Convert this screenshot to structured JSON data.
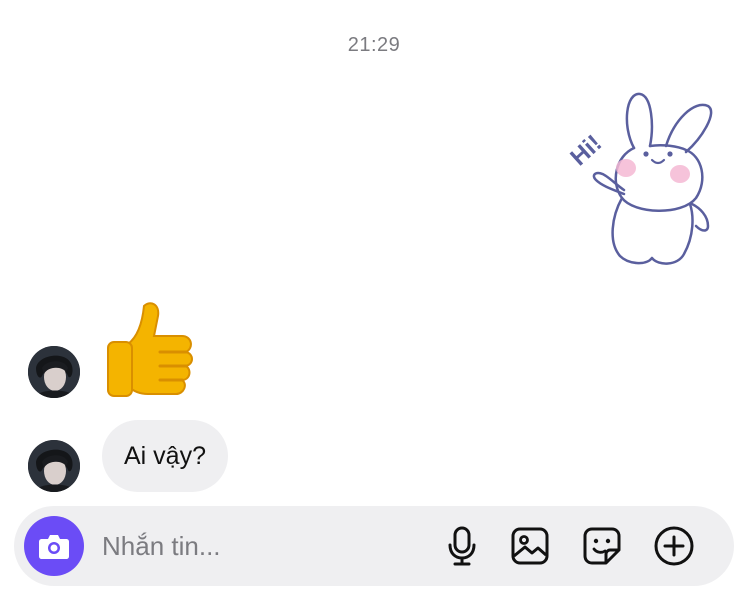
{
  "chat": {
    "timestamp": "21:29",
    "messages": [
      {
        "type": "sticker",
        "sender": "me",
        "sticker_text": "Hi!",
        "sticker": "bunny-waving-sticker"
      },
      {
        "type": "emoji",
        "sender": "other",
        "emoji": "thumbs-up"
      },
      {
        "type": "text",
        "sender": "other",
        "text": "Ai vậy?"
      }
    ]
  },
  "composer": {
    "placeholder": "Nhắn tin...",
    "value": "",
    "icons": [
      "camera-icon",
      "microphone-icon",
      "gallery-icon",
      "sticker-icon",
      "plus-icon"
    ]
  },
  "colors": {
    "accent": "#6b4cf6",
    "bubble": "#efeff1",
    "timestamp": "#7b7b80"
  }
}
